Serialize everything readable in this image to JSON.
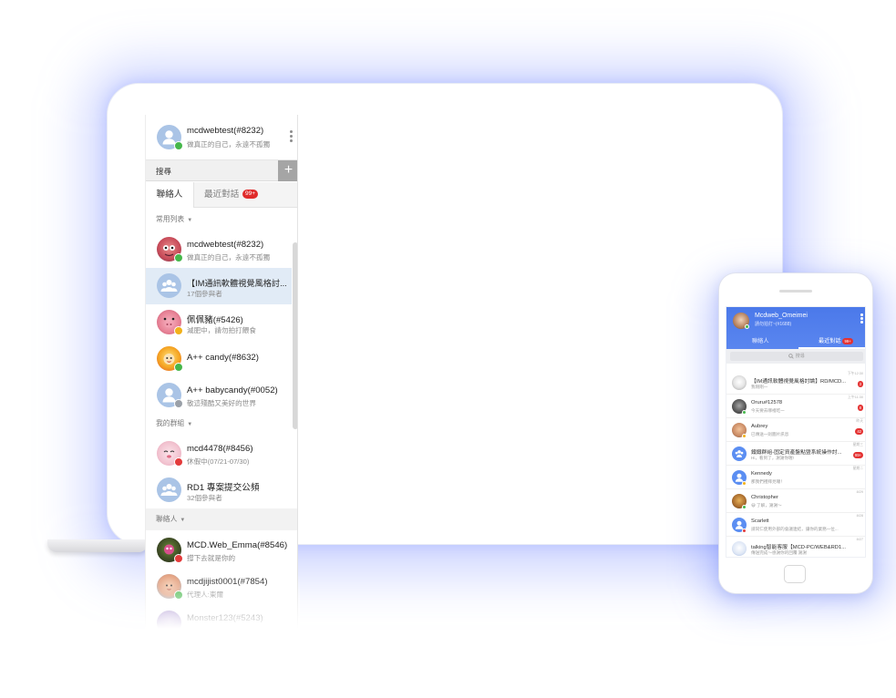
{
  "desktop": {
    "me": {
      "name": "mcdwebtest(#8232)",
      "status": "做真正的自己，永遠不孤獨"
    },
    "search_label": "搜尋",
    "add_button": "+",
    "tabs": {
      "contacts": "聯絡人",
      "recent": "最近對話",
      "recent_badge": "99+"
    },
    "sections": {
      "favorites": "常用列表",
      "groups": "我的群組",
      "contacts": "聯絡人",
      "caret": "▼"
    },
    "favorites": [
      {
        "name": "mcdwebtest(#8232)",
        "status": "做真正的自己，永遠不孤獨"
      },
      {
        "name": "【IM通訊軟體視覺風格討...",
        "status": "17個參與者"
      },
      {
        "name": "佩佩豬(#5426)",
        "status": "減肥中，請勿拍打餵食"
      },
      {
        "name": "A++ candy(#8632)",
        "status": ""
      },
      {
        "name": "A++ babycandy(#0052)",
        "status": "敬這殘酷又美好的世界"
      }
    ],
    "groups": [
      {
        "name": "mcd4478(#8456)",
        "status": "休假中(07/21-07/30)"
      },
      {
        "name": "RD1 專案提交公頻",
        "status": "32個參與者"
      }
    ],
    "contacts": [
      {
        "name": "MCD.Web_Emma(#8546)",
        "status": "撐下去就是你的"
      },
      {
        "name": "mcdjijist0001(#7854)",
        "status": "代理人:東爾"
      },
      {
        "name": "Monster123(#5243)",
        "status": ""
      }
    ]
  },
  "mobile": {
    "me": {
      "name": "Mcdweb_Omeimei",
      "status": "請勿拍打~(#1688)"
    },
    "tabs": {
      "contacts": "聯絡人",
      "recent": "最近對話",
      "recent_badge": "99+"
    },
    "search_placeholder": "搜尋",
    "conversations": [
      {
        "name": "【IM通訊軟體視覺風格討論】RD/MCD...",
        "preview": "我剛剛一",
        "time": "下午12:30",
        "badge": "3"
      },
      {
        "name": "Oruru#12578",
        "preview": "今天要去哪裡吃一",
        "time": "上午11:30",
        "badge": "8"
      },
      {
        "name": "Aubrey",
        "preview": "已傳送一則圖片訊息",
        "time": "昨天",
        "badge": "42"
      },
      {
        "name": "鐵鐵群組-固定資產盤點暨系統操作討...",
        "preview": "Hi，看到了，謝謝你喔!",
        "time": "星期三",
        "badge": "99+"
      },
      {
        "name": "Kennedy",
        "preview": "那我們禮拜見囉！",
        "time": "星期二",
        "badge": ""
      },
      {
        "name": "Christopher",
        "preview": "😀 了解，謝謝～",
        "time": "8/29",
        "badge": ""
      },
      {
        "name": "Scarlett",
        "preview": "請同仁使用外部的會議連結，讓你的業務一位...",
        "time": "8/28",
        "badge": ""
      },
      {
        "name": "talking智能客服【MCD-PC/WEB&RD1...",
        "preview": "傳送完成～感謝你的回覆 謝謝",
        "time": "8/27",
        "badge": ""
      }
    ]
  }
}
